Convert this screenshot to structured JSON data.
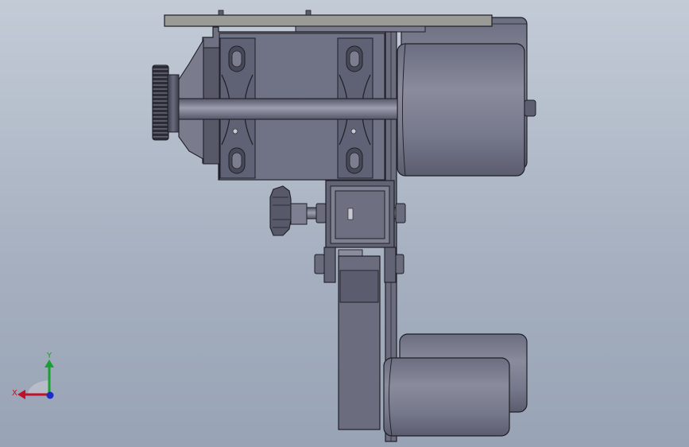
{
  "viewport": {
    "background_top": "#c3cbd7",
    "background_bottom": "#98a3b5"
  },
  "model": {
    "parts": [
      "top-plate",
      "motor-rear",
      "bearing-housing",
      "timing-pulley",
      "shaft",
      "motor-front",
      "vertical-rail",
      "clamp-block",
      "locking-knob",
      "hinge-bracket",
      "support-column",
      "roller-rear",
      "roller-front"
    ],
    "colors": {
      "body": "#6f7183",
      "body_dark": "#4e5062",
      "body_light": "#8d8fa0",
      "motor": "#74768a",
      "plate": "#9a9a96",
      "outline": "#1e1f26"
    }
  },
  "triad": {
    "x_label": "X",
    "y_label": "Y",
    "x_color": "#c0102a",
    "y_color": "#1aa032",
    "z_color": "#1c2ac8"
  }
}
